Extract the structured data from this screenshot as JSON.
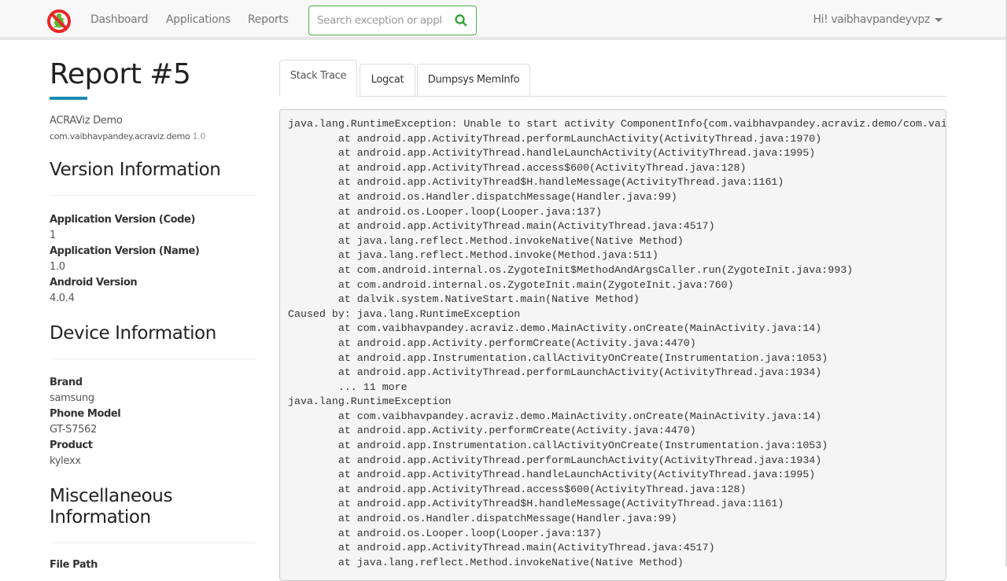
{
  "navbar": {
    "logo_icon": "no-bugs-logo-icon",
    "links": [
      {
        "label": "Dashboard"
      },
      {
        "label": "Applications"
      },
      {
        "label": "Reports"
      }
    ],
    "search": {
      "placeholder": "Search exception or application",
      "value": "",
      "icon": "search-icon"
    },
    "user_menu": {
      "label": "Hi! vaibhavpandeyvpz",
      "icon": "caret-down-icon"
    }
  },
  "sidebar": {
    "title": "Report #5",
    "app_name": "ACRAViz Demo",
    "package": "com.vaibhavpandey.acraviz.demo",
    "package_version": "1.0",
    "sections": [
      {
        "title": "Version Information",
        "props": [
          {
            "label": "Application Version (Code)",
            "value": "1"
          },
          {
            "label": "Application Version (Name)",
            "value": "1.0"
          },
          {
            "label": "Android Version",
            "value": "4.0.4"
          }
        ]
      },
      {
        "title": "Device Information",
        "props": [
          {
            "label": "Brand",
            "value": "samsung"
          },
          {
            "label": "Phone Model",
            "value": "GT-S7562"
          },
          {
            "label": "Product",
            "value": "kylexx"
          }
        ]
      },
      {
        "title": "Miscellaneous Information",
        "props": [
          {
            "label": "File Path",
            "value": ""
          }
        ]
      }
    ]
  },
  "tabs": [
    {
      "label": "Stack Trace",
      "active": true
    },
    {
      "label": "Logcat",
      "active": false
    },
    {
      "label": "Dumpsys MemInfo",
      "active": false
    }
  ],
  "stack_trace": "java.lang.RuntimeException: Unable to start activity ComponentInfo{com.vaibhavpandey.acraviz.demo/com.vaibhavpandey.acraviz.demo.MainActivity}: java.lang.RuntimeException\n\tat android.app.ActivityThread.performLaunchActivity(ActivityThread.java:1970)\n\tat android.app.ActivityThread.handleLaunchActivity(ActivityThread.java:1995)\n\tat android.app.ActivityThread.access$600(ActivityThread.java:128)\n\tat android.app.ActivityThread$H.handleMessage(ActivityThread.java:1161)\n\tat android.os.Handler.dispatchMessage(Handler.java:99)\n\tat android.os.Looper.loop(Looper.java:137)\n\tat android.app.ActivityThread.main(ActivityThread.java:4517)\n\tat java.lang.reflect.Method.invokeNative(Native Method)\n\tat java.lang.reflect.Method.invoke(Method.java:511)\n\tat com.android.internal.os.ZygoteInit$MethodAndArgsCaller.run(ZygoteInit.java:993)\n\tat com.android.internal.os.ZygoteInit.main(ZygoteInit.java:760)\n\tat dalvik.system.NativeStart.main(Native Method)\nCaused by: java.lang.RuntimeException\n\tat com.vaibhavpandey.acraviz.demo.MainActivity.onCreate(MainActivity.java:14)\n\tat android.app.Activity.performCreate(Activity.java:4470)\n\tat android.app.Instrumentation.callActivityOnCreate(Instrumentation.java:1053)\n\tat android.app.ActivityThread.performLaunchActivity(ActivityThread.java:1934)\n\t... 11 more\njava.lang.RuntimeException\n\tat com.vaibhavpandey.acraviz.demo.MainActivity.onCreate(MainActivity.java:14)\n\tat android.app.Activity.performCreate(Activity.java:4470)\n\tat android.app.Instrumentation.callActivityOnCreate(Instrumentation.java:1053)\n\tat android.app.ActivityThread.performLaunchActivity(ActivityThread.java:1934)\n\tat android.app.ActivityThread.handleLaunchActivity(ActivityThread.java:1995)\n\tat android.app.ActivityThread.access$600(ActivityThread.java:128)\n\tat android.app.ActivityThread$H.handleMessage(ActivityThread.java:1161)\n\tat android.os.Handler.dispatchMessage(Handler.java:99)\n\tat android.os.Looper.loop(Looper.java:137)\n\tat android.app.ActivityThread.main(ActivityThread.java:4517)\n\tat java.lang.reflect.Method.invokeNative(Native Method)",
  "colors": {
    "accent": "#1b8bb3",
    "search_border": "#4cae4c",
    "logo_red": "#e8272b",
    "logo_green": "#5cb82a"
  }
}
